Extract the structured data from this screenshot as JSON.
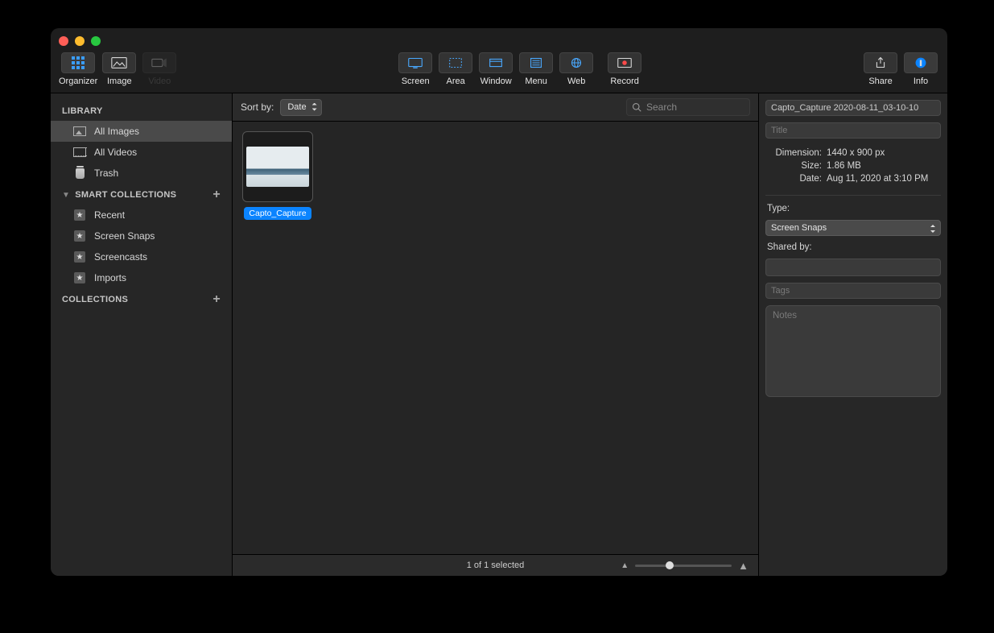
{
  "toolbar": {
    "left": [
      {
        "id": "organizer",
        "label": "Organizer",
        "active": true
      },
      {
        "id": "image",
        "label": "Image"
      },
      {
        "id": "video",
        "label": "Video",
        "disabled": true
      }
    ],
    "capture": [
      {
        "id": "screen",
        "label": "Screen"
      },
      {
        "id": "area",
        "label": "Area"
      },
      {
        "id": "window",
        "label": "Window"
      },
      {
        "id": "menu",
        "label": "Menu"
      },
      {
        "id": "web",
        "label": "Web"
      },
      {
        "id": "record",
        "label": "Record"
      }
    ],
    "right": [
      {
        "id": "share",
        "label": "Share"
      },
      {
        "id": "info",
        "label": "Info",
        "accent": true
      }
    ]
  },
  "sidebar": {
    "library_header": "LIBRARY",
    "library": [
      {
        "id": "all-images",
        "label": "All Images",
        "selected": true
      },
      {
        "id": "all-videos",
        "label": "All Videos"
      },
      {
        "id": "trash",
        "label": "Trash"
      }
    ],
    "smart_header": "SMART COLLECTIONS",
    "smart": [
      {
        "id": "recent",
        "label": "Recent"
      },
      {
        "id": "screen-snaps",
        "label": "Screen Snaps"
      },
      {
        "id": "screencasts",
        "label": "Screencasts"
      },
      {
        "id": "imports",
        "label": "Imports"
      }
    ],
    "collections_header": "COLLECTIONS"
  },
  "main": {
    "sort_label": "Sort by:",
    "sort_value": "Date",
    "search_placeholder": "Search",
    "items": [
      {
        "filename": "Capto_Capture"
      }
    ],
    "status": "1 of 1 selected"
  },
  "inspector": {
    "filename": "Capto_Capture 2020-08-11_03-10-10",
    "title_placeholder": "Title",
    "dimension_label": "Dimension:",
    "dimension_value": "1440 x 900 px",
    "size_label": "Size:",
    "size_value": "1.86 MB",
    "date_label": "Date:",
    "date_value": "Aug 11, 2020 at 3:10 PM",
    "type_label": "Type:",
    "type_value": "Screen Snaps",
    "sharedby_label": "Shared by:",
    "tags_placeholder": "Tags",
    "notes_placeholder": "Notes"
  }
}
